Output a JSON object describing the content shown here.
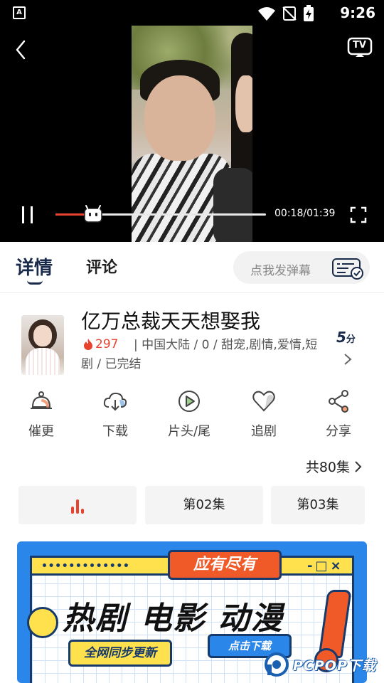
{
  "status_bar": {
    "notification_letter": "A",
    "time": "9:26"
  },
  "player": {
    "current_time": "00:18/01:39",
    "progress_fraction": 0.18,
    "tv_label": "TV"
  },
  "tabs": {
    "details": "详情",
    "comments": "评论",
    "danmu_placeholder": "点我发弹幕"
  },
  "show": {
    "title": "亿万总裁天天想娶我",
    "hot_count": "297",
    "meta": "| 中国大陆 / 0 / 甜宠,剧情,爱情,短剧 / 已完结",
    "score_value": "5",
    "score_unit": "分"
  },
  "actions": [
    {
      "label": "催更",
      "icon": "bell-icon"
    },
    {
      "label": "下载",
      "icon": "cloud-download-icon"
    },
    {
      "label": "片头/尾",
      "icon": "play-circle-icon"
    },
    {
      "label": "追剧",
      "icon": "heart-icon"
    },
    {
      "label": "分享",
      "icon": "share-icon"
    }
  ],
  "episodes": {
    "total_label": "共80集",
    "items": [
      "第02集",
      "第03集"
    ]
  },
  "banner": {
    "tag": "应有尽有",
    "headline": "热剧 电影 动漫",
    "sync_label": "全网同步更新",
    "click_label": "点击下载",
    "window_controls": "-□×"
  },
  "watermark": {
    "text": "PCPOP下载"
  },
  "colors": {
    "accent": "#e8432e",
    "navy": "#1a2a4a",
    "banner_blue": "#2a86e8",
    "banner_orange": "#f05a28",
    "banner_yellow": "#ffe14d"
  }
}
